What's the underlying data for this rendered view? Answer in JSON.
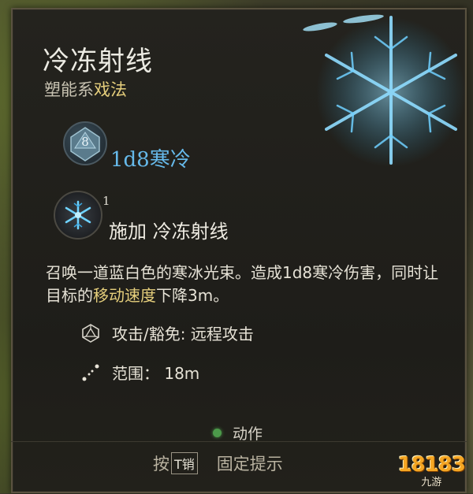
{
  "tooltip": {
    "title": "冷冻射线",
    "school": "塑能系",
    "spell_type": "戏法",
    "die_face": "8",
    "damage": "1d8寒冷",
    "spell_count": "1",
    "apply_label": "施加 冷冻射线",
    "description": {
      "part1": "召唤一道蓝白色的寒冰光束。造成1d8寒冷伤害，同时让目标的",
      "highlight": "移动速度",
      "part2": "下降3m。"
    },
    "attack_save": "攻击/豁免: 远程攻击",
    "range": "范围： 18m",
    "action": "动作"
  },
  "footer": {
    "pin_prefix": "按",
    "pin_key": "T",
    "pin_key_extra": "销",
    "pin_label": "固定提示"
  },
  "watermark": {
    "number": "18183",
    "sub": "九游"
  },
  "colors": {
    "cold_blue": "#66b9ea",
    "highlight_gold": "#e6cf7c",
    "action_green": "#4c9a4a"
  }
}
